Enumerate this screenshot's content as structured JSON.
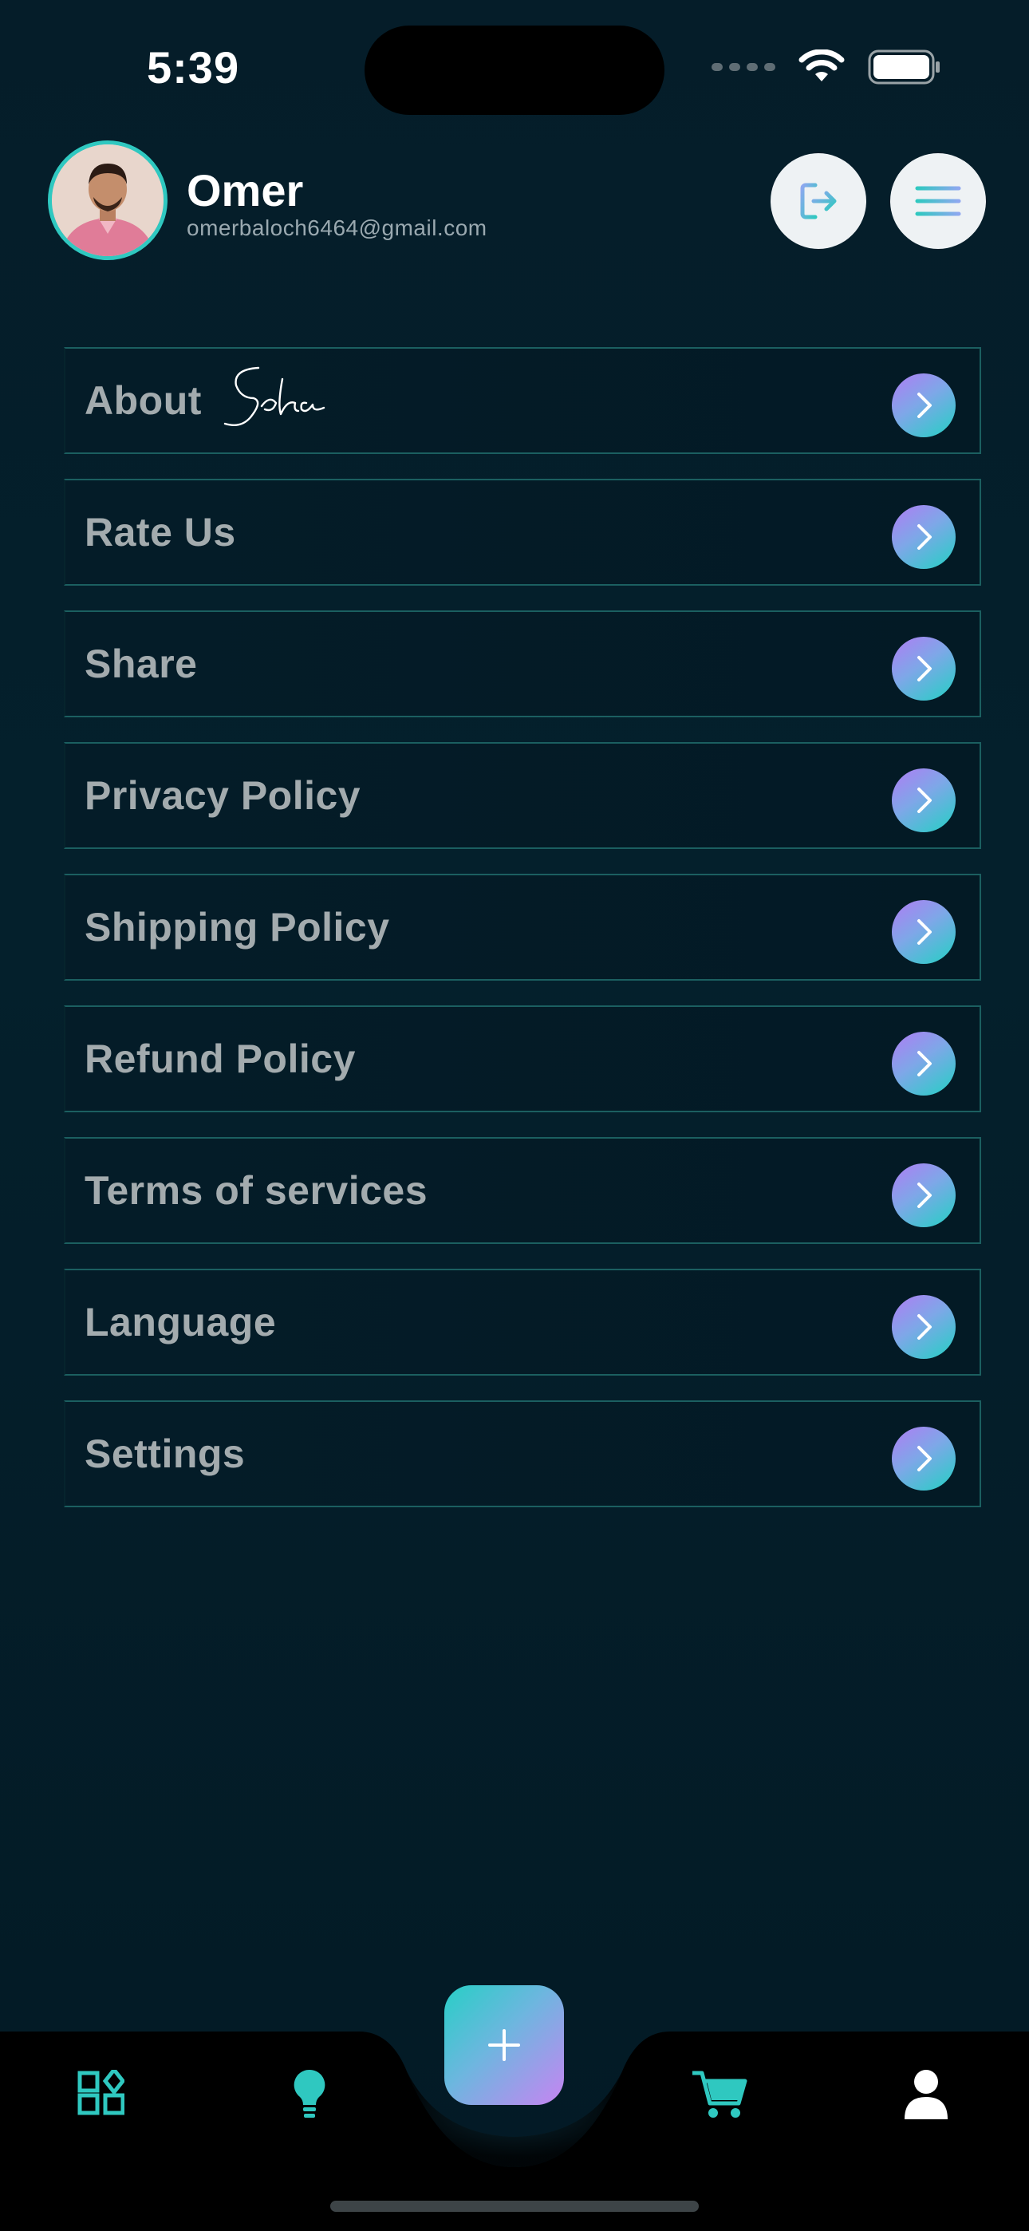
{
  "status_bar": {
    "time": "5:39"
  },
  "profile": {
    "name": "Omer",
    "email": "omerbaloch6464@gmail.com"
  },
  "header_buttons": {
    "logout_icon": "logout-icon",
    "menu_icon": "hamburger-icon"
  },
  "menu": {
    "items": [
      {
        "label": "About",
        "brand": "Soha"
      },
      {
        "label": "Rate Us"
      },
      {
        "label": "Share"
      },
      {
        "label": "Privacy Policy"
      },
      {
        "label": "Shipping Policy"
      },
      {
        "label": "Refund Policy"
      },
      {
        "label": "Terms of services"
      },
      {
        "label": "Language"
      },
      {
        "label": "Settings"
      }
    ]
  },
  "bottom_nav": {
    "items": [
      "dashboard-icon",
      "lightbulb-icon",
      "add-icon",
      "cart-icon",
      "profile-icon"
    ]
  },
  "colors": {
    "background": "#041c28",
    "accent_teal": "#2fc8c0",
    "accent_purple": "#c784f2",
    "item_border": "#1b5f60",
    "label_gray": "#a3abae"
  }
}
